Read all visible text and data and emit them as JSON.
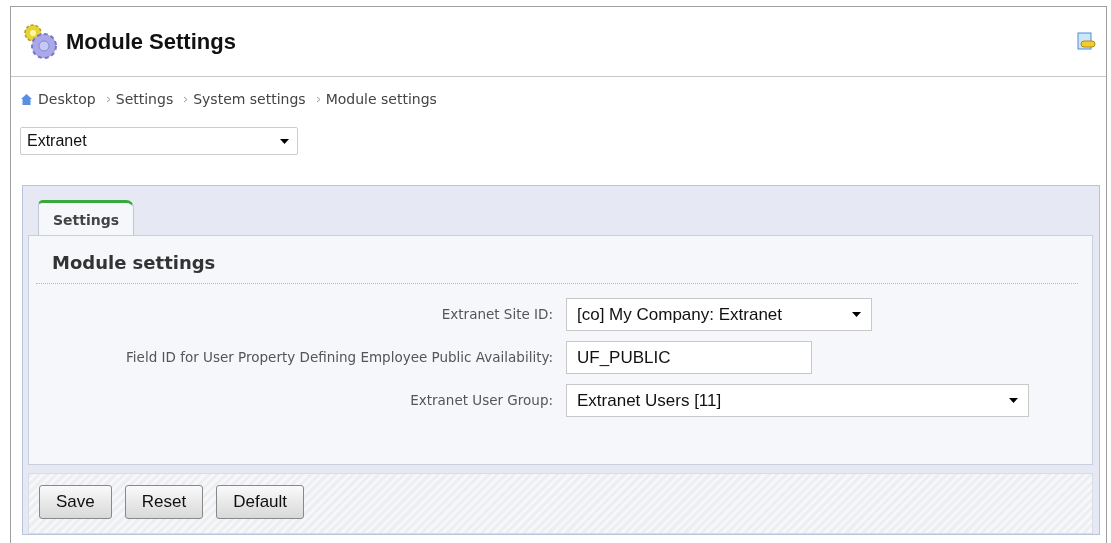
{
  "window": {
    "title": "Module Settings"
  },
  "breadcrumb": [
    "Desktop",
    "Settings",
    "System settings",
    "Module settings"
  ],
  "module_select": {
    "value": "Extranet"
  },
  "tabs": [
    {
      "label": "Settings",
      "selected": true
    }
  ],
  "section_title": "Module settings",
  "fields": [
    {
      "kind": "select",
      "label": "Extranet Site ID:",
      "value": "[co] My Company: Extranet"
    },
    {
      "kind": "text",
      "label": "Field ID for User Property Defining Employee Public Availability:",
      "value": "UF_PUBLIC"
    },
    {
      "kind": "select",
      "label": "Extranet User Group:",
      "value": "Extranet Users [11]"
    }
  ],
  "buttons": [
    "Save",
    "Reset",
    "Default"
  ]
}
